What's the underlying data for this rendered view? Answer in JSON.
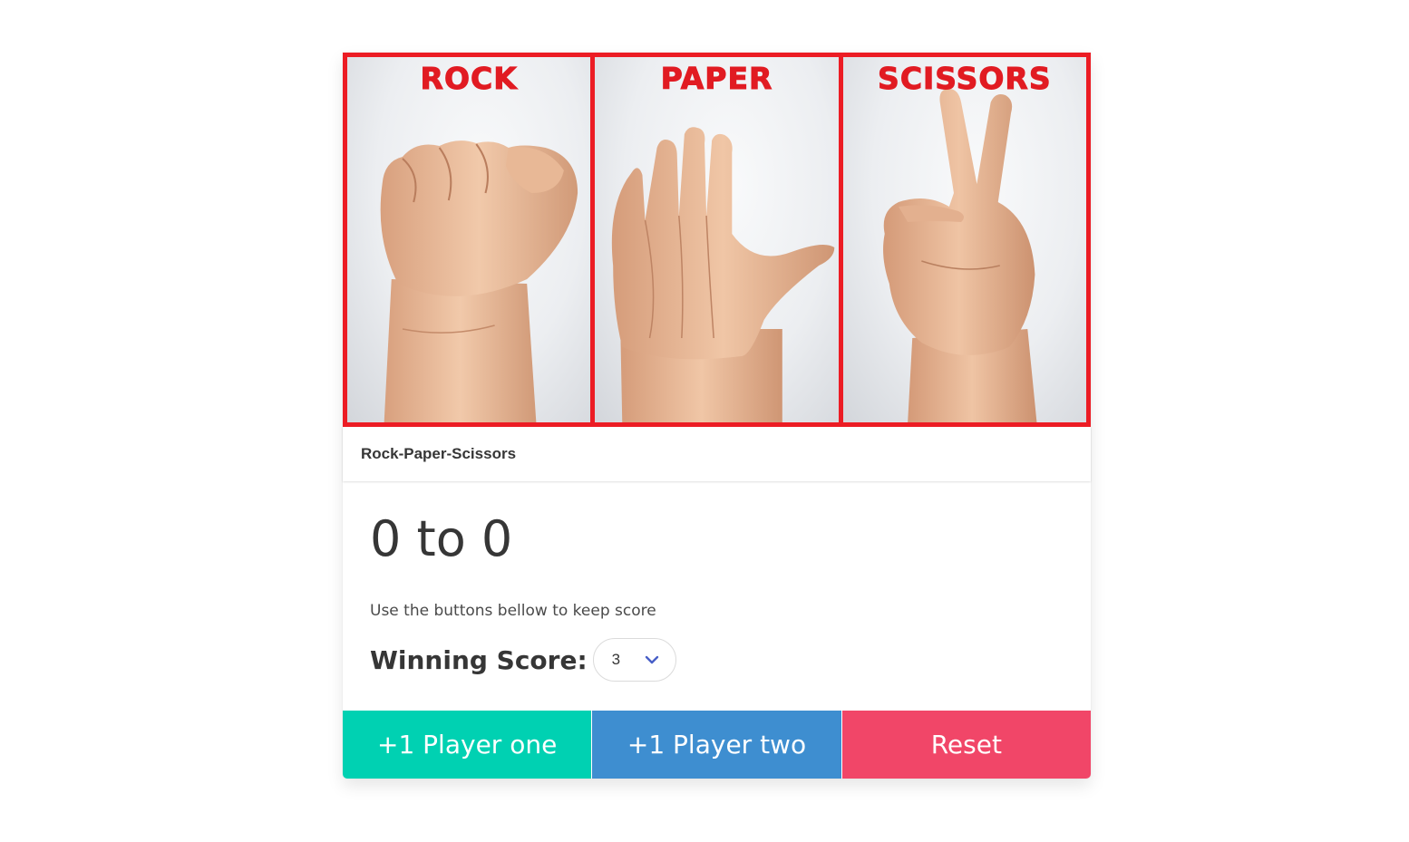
{
  "banner": {
    "panels": [
      {
        "label": "ROCK",
        "hand": "fist-hand-icon"
      },
      {
        "label": "PAPER",
        "hand": "open-hand-icon"
      },
      {
        "label": "SCISSORS",
        "hand": "peace-hand-icon"
      }
    ],
    "border_color": "#ec1c24",
    "label_color": "#e11b22"
  },
  "header": {
    "title": "Rock-Paper-Scissors"
  },
  "content": {
    "score_text": "0 to 0",
    "hint": "Use the buttons bellow to keep score",
    "winning_label": "Winning Score:",
    "winning_value": "3"
  },
  "footer": {
    "player_one_label": "+1 Player one",
    "player_two_label": "+1 Player two",
    "reset_label": "Reset",
    "colors": {
      "player_one": "#00d1b2",
      "player_two": "#3e8ed0",
      "reset": "#f14668"
    }
  }
}
